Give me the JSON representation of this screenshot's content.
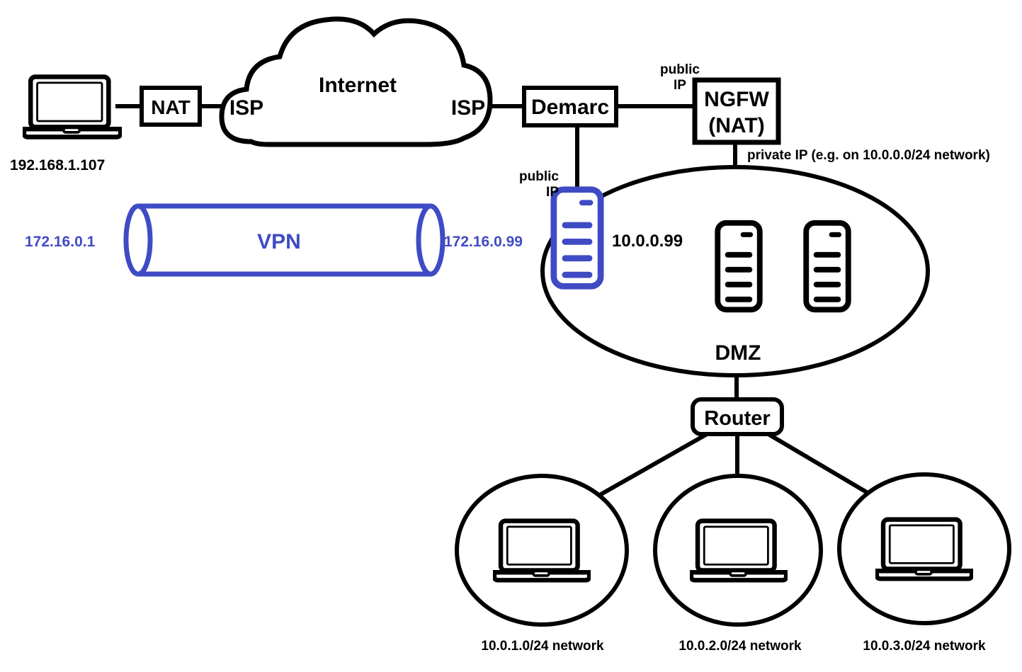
{
  "diagram": {
    "title": "Network topology with VPN, Demarc, NGFW, DMZ and routed subnets",
    "colors": {
      "line": "#000000",
      "vpn_accent": "#3f4bc4",
      "background": "#ffffff"
    }
  },
  "client": {
    "icon": "laptop-icon",
    "ip_label": "192.168.1.107"
  },
  "nat_box": {
    "label": "NAT"
  },
  "internet": {
    "label": "Internet",
    "isp_left_label": "ISP",
    "isp_right_label": "ISP"
  },
  "demarc": {
    "label": "Demarc"
  },
  "ngfw": {
    "line1": "NGFW",
    "line2": "(NAT)",
    "uplink_annotation_line1": "public",
    "uplink_annotation_line2": "IP",
    "downlink_annotation": "private IP (e.g. on 10.0.0.0/24 network)"
  },
  "vpn": {
    "label": "VPN",
    "left_ip": "172.16.0.1",
    "right_ip": "172.16.0.99"
  },
  "vpn_concentrator": {
    "icon": "server-icon",
    "public_ip_annotation_line1": "public",
    "public_ip_annotation_line2": "IP",
    "private_ip_label": "10.0.0.99"
  },
  "dmz": {
    "label": "DMZ",
    "servers": [
      {
        "icon": "server-icon"
      },
      {
        "icon": "server-icon"
      }
    ]
  },
  "router": {
    "label": "Router"
  },
  "subnets": [
    {
      "icon": "laptop-icon",
      "label": "10.0.1.0/24 network"
    },
    {
      "icon": "laptop-icon",
      "label": "10.0.2.0/24 network"
    },
    {
      "icon": "laptop-icon",
      "label": "10.0.3.0/24 network"
    }
  ]
}
